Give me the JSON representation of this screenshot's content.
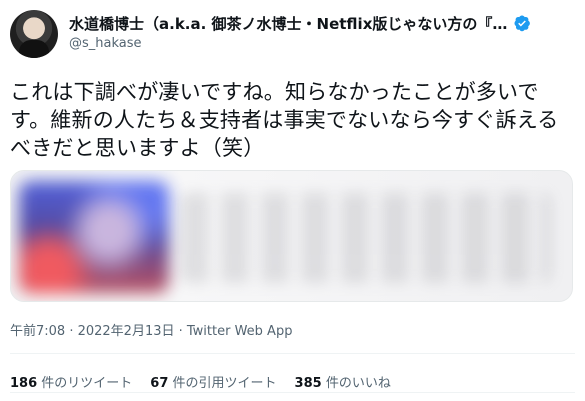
{
  "author": {
    "display_name": "水道橋博士（a.k.a. 御茶ノ水博士・Netflix版じゃない方の『浅…",
    "handle": "@s_hakase",
    "verified": true,
    "verified_color": "#1d9bf0"
  },
  "tweet": {
    "text": "これは下調べが凄いですね。知らなかったことが多いです。維新の人たち＆支持者は事実でないなら今すぐ訴えるべきだと思いますよ（笑）",
    "timestamp": "午前7:08 · 2022年2月13日 · Twitter Web App",
    "media_blurred": true
  },
  "stats": {
    "retweets_count": "186",
    "retweets_label": "件のリツイート",
    "quotes_count": "67",
    "quotes_label": "件の引用ツイート",
    "likes_count": "385",
    "likes_label": "件のいいね"
  }
}
